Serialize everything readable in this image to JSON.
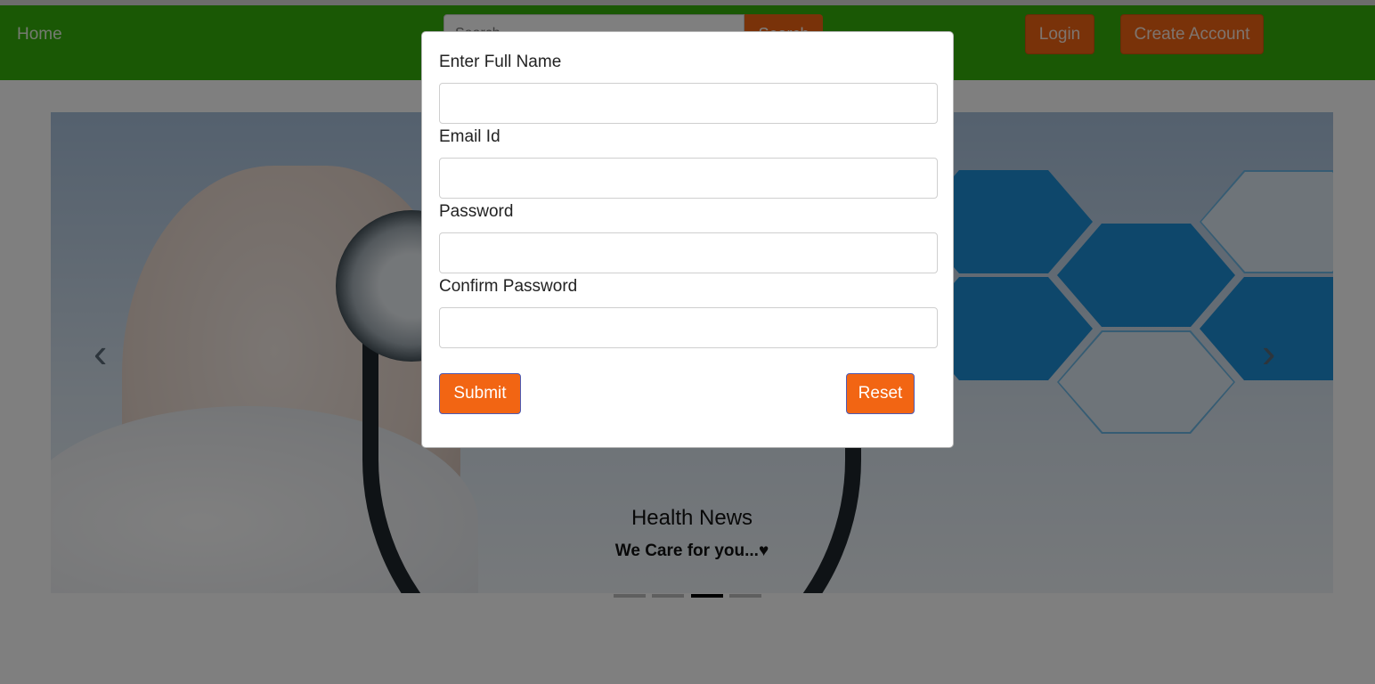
{
  "navbar": {
    "home_label": "Home",
    "search_placeholder": "Search",
    "search_button": "Search",
    "login_label": "Login",
    "create_account_label": "Create Account"
  },
  "carousel": {
    "caption_title": "Health News",
    "caption_text": "We Care for you...♥",
    "prev_icon": "‹",
    "next_icon": "›",
    "indicator_count": 4,
    "active_indicator": 3
  },
  "modal": {
    "fields": [
      {
        "label": "Enter Full Name",
        "value": "",
        "type": "text"
      },
      {
        "label": "Email Id",
        "value": "",
        "type": "email"
      },
      {
        "label": "Password",
        "value": "",
        "type": "password"
      },
      {
        "label": "Confirm Password",
        "value": "",
        "type": "password"
      }
    ],
    "submit_label": "Submit",
    "reset_label": "Reset"
  },
  "colors": {
    "navbar": "#34b10a",
    "accent": "#f26513",
    "overlay": "rgba(0,0,0,0.5)"
  }
}
